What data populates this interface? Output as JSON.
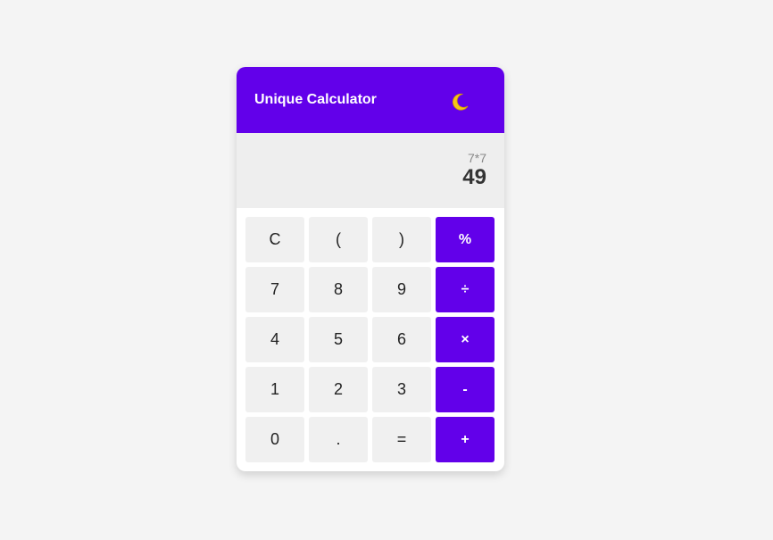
{
  "app": {
    "title": "Unique Calculator",
    "theme_icon": "moon-icon"
  },
  "display": {
    "expression": "7*7",
    "result": "49"
  },
  "keys": [
    {
      "label": "C",
      "name": "clear-button",
      "type": "func"
    },
    {
      "label": "(",
      "name": "open-paren-button",
      "type": "func"
    },
    {
      "label": ")",
      "name": "close-paren-button",
      "type": "func"
    },
    {
      "label": "%",
      "name": "percent-button",
      "type": "op"
    },
    {
      "label": "7",
      "name": "digit-7-button",
      "type": "num"
    },
    {
      "label": "8",
      "name": "digit-8-button",
      "type": "num"
    },
    {
      "label": "9",
      "name": "digit-9-button",
      "type": "num"
    },
    {
      "label": "÷",
      "name": "divide-button",
      "type": "op"
    },
    {
      "label": "4",
      "name": "digit-4-button",
      "type": "num"
    },
    {
      "label": "5",
      "name": "digit-5-button",
      "type": "num"
    },
    {
      "label": "6",
      "name": "digit-6-button",
      "type": "num"
    },
    {
      "label": "×",
      "name": "multiply-button",
      "type": "op"
    },
    {
      "label": "1",
      "name": "digit-1-button",
      "type": "num"
    },
    {
      "label": "2",
      "name": "digit-2-button",
      "type": "num"
    },
    {
      "label": "3",
      "name": "digit-3-button",
      "type": "num"
    },
    {
      "label": "-",
      "name": "subtract-button",
      "type": "op"
    },
    {
      "label": "0",
      "name": "digit-0-button",
      "type": "num"
    },
    {
      "label": ".",
      "name": "decimal-button",
      "type": "num"
    },
    {
      "label": "=",
      "name": "equals-button",
      "type": "func"
    },
    {
      "label": "+",
      "name": "add-button",
      "type": "op"
    }
  ],
  "colors": {
    "accent": "#6200ea",
    "background": "#f4f4f4",
    "display_bg": "#eeeeee",
    "key_bg": "#f0f0f0"
  }
}
